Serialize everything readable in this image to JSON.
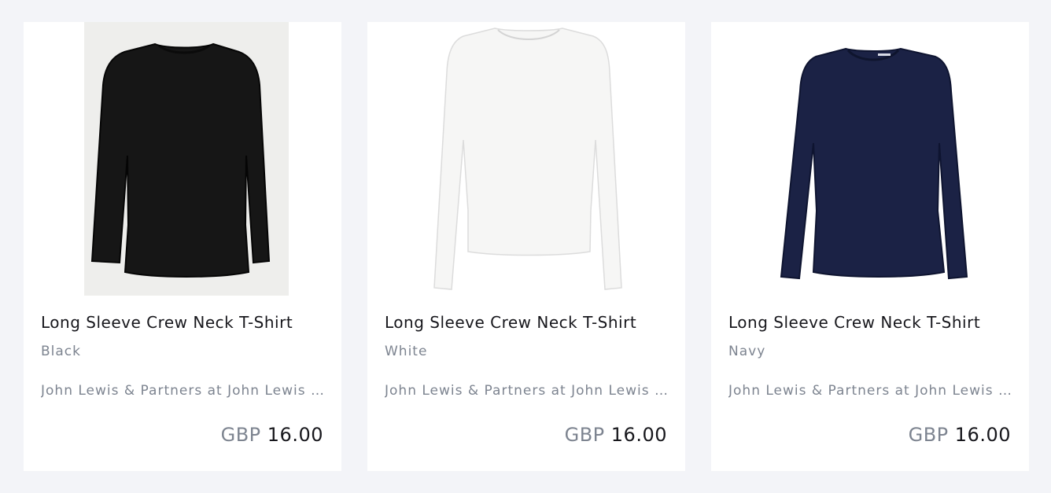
{
  "products": [
    {
      "title": "Long Sleeve Crew Neck T-Shirt",
      "colour": "Black",
      "seller": "John Lewis & Partners at John Lewis & Partners",
      "currency": "GBP",
      "price": "16.00",
      "image_background": "#eeeeec",
      "garment_color": "#161616",
      "garment_outline": "#050505"
    },
    {
      "title": "Long Sleeve Crew Neck T-Shirt",
      "colour": "White",
      "seller": "John Lewis & Partners at John Lewis & Partners",
      "currency": "GBP",
      "price": "16.00",
      "image_background": "#ffffff",
      "garment_color": "#f6f6f5",
      "garment_outline": "#dcdcdc"
    },
    {
      "title": "Long Sleeve Crew Neck T-Shirt",
      "colour": "Navy",
      "seller": "John Lewis & Partners at John Lewis & Partners",
      "currency": "GBP",
      "price": "16.00",
      "image_background": "#ffffff",
      "garment_color": "#1b2245",
      "garment_outline": "#0e1430"
    }
  ]
}
